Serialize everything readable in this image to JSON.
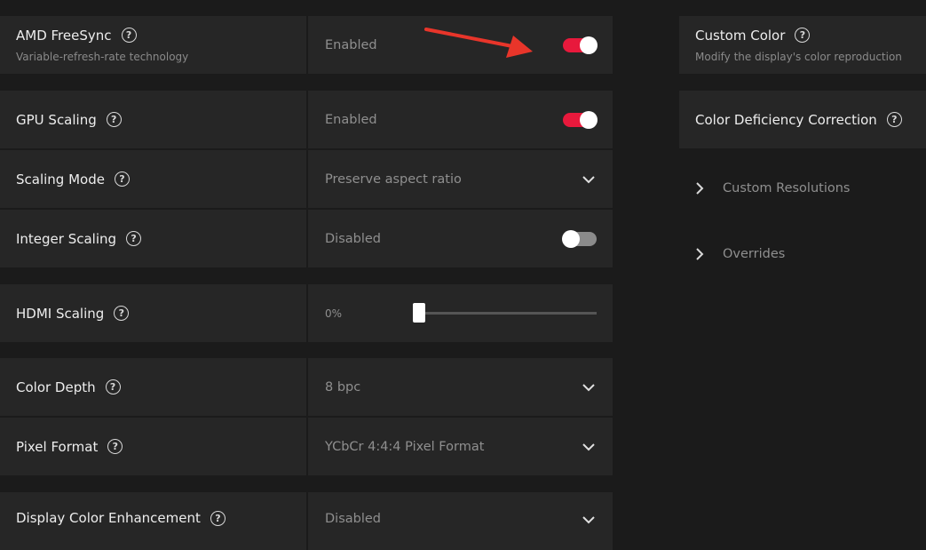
{
  "settings": [
    {
      "label": "AMD FreeSync",
      "subtitle": "Variable-refresh-rate technology",
      "value": "Enabled",
      "control": "toggle",
      "state": "on"
    },
    {
      "label": "GPU Scaling",
      "value": "Enabled",
      "control": "toggle",
      "state": "on"
    },
    {
      "label": "Scaling Mode",
      "value": "Preserve aspect ratio",
      "control": "dropdown"
    },
    {
      "label": "Integer Scaling",
      "value": "Disabled",
      "control": "toggle",
      "state": "off"
    },
    {
      "label": "HDMI Scaling",
      "value": "0%",
      "control": "slider",
      "level": 0
    },
    {
      "label": "Color Depth",
      "value": "8 bpc",
      "control": "dropdown"
    },
    {
      "label": "Pixel Format",
      "value": "YCbCr 4:4:4 Pixel Format",
      "control": "dropdown"
    },
    {
      "label": "Display Color Enhancement",
      "value": "Disabled",
      "control": "dropdown"
    }
  ],
  "right_panels": [
    {
      "label": "Custom Color",
      "subtitle": "Modify the display's color reproduction"
    },
    {
      "label": "Color Deficiency Correction"
    }
  ],
  "expanders": [
    {
      "label": "Custom Resolutions"
    },
    {
      "label": "Overrides"
    }
  ],
  "colors": {
    "accent": "#e8193c",
    "annotation_arrow": "#e8352a"
  },
  "icons": {
    "help": "?"
  }
}
